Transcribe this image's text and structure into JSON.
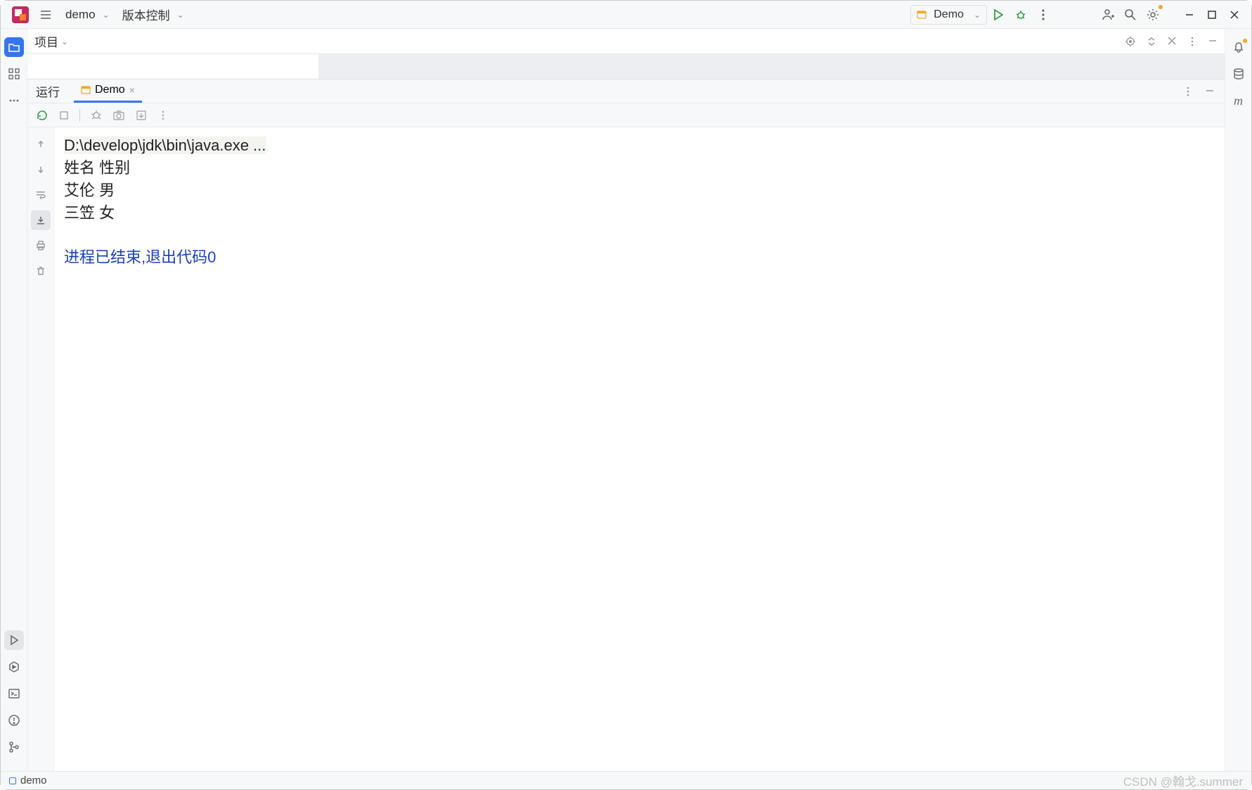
{
  "topbar": {
    "project": "demo",
    "vcs_label": "版本控制",
    "run_config": "Demo"
  },
  "project_panel": {
    "title": "项目"
  },
  "run_panel": {
    "label": "运行",
    "tab": "Demo"
  },
  "console": {
    "cmd": "D:\\develop\\jdk\\bin\\java.exe ...",
    "lines": [
      "姓名  性别",
      "艾伦  男",
      "三笠  女"
    ],
    "exit": "进程已结束,退出代码0"
  },
  "status": {
    "project": "demo",
    "watermark": "CSDN @翰戈.summer"
  }
}
